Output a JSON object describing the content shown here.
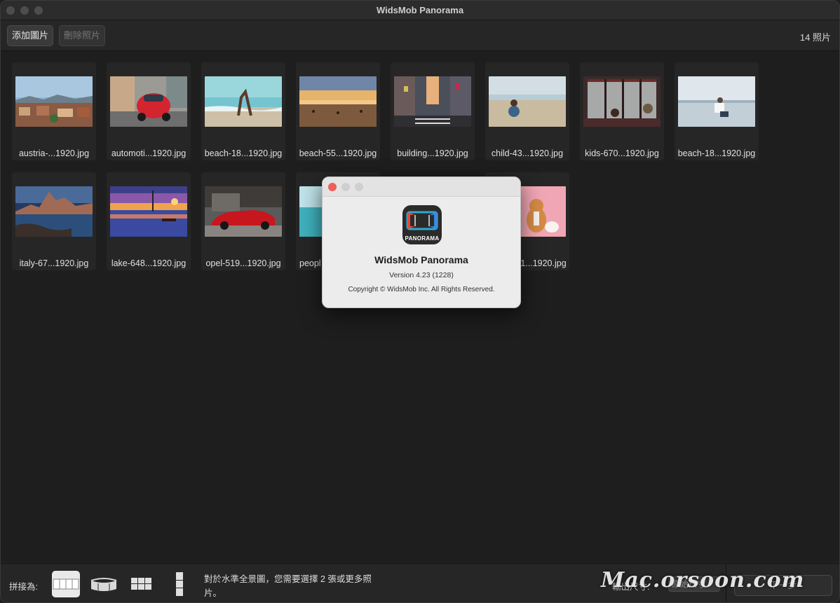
{
  "window": {
    "title": "WidsMob Panorama"
  },
  "toolbar": {
    "add_label": "添加圖片",
    "delete_label": "刪除照片",
    "photo_count": "14 照片"
  },
  "photos": [
    {
      "name": "austria-...1920.jpg",
      "scene": "austria-town"
    },
    {
      "name": "automoti...1920.jpg",
      "scene": "red-beetle-car"
    },
    {
      "name": "beach-18...1920.jpg",
      "scene": "beach-yoga"
    },
    {
      "name": "beach-55...1920.jpg",
      "scene": "beach-sunset"
    },
    {
      "name": "building...1920.jpg",
      "scene": "city-street"
    },
    {
      "name": "child-43...1920.jpg",
      "scene": "child-beach"
    },
    {
      "name": "kids-670...1920.jpg",
      "scene": "kids-window"
    },
    {
      "name": "beach-18...1920.jpg",
      "scene": "beach-sitting"
    },
    {
      "name": "italy-67...1920.jpg",
      "scene": "mountain-lake"
    },
    {
      "name": "lake-648...1920.jpg",
      "scene": "lake-sunset"
    },
    {
      "name": "opel-519...1920.jpg",
      "scene": "red-sports-car"
    },
    {
      "name": "peopl",
      "scene": "people-sea"
    },
    {
      "name": "1...1920.jpg",
      "scene": "corgi-pink"
    }
  ],
  "bottombar": {
    "stitch_label": "拼接為:",
    "modes": [
      "horizontal-panorama-icon",
      "360-panorama-icon",
      "grid-icon",
      "vertical-panorama-icon"
    ],
    "hint": "對於水準全景圖，您需要選擇 2 張或更多照片。",
    "output_label": "輸出尺寸:",
    "output_value": "原始尺寸",
    "next_label": "下一步"
  },
  "watermark": "Mac.orsoon.com",
  "about": {
    "icon_label": "PANORAMA",
    "name": "WidsMob Panorama",
    "version": "Version 4.23 (1228)",
    "copyright": "Copyright © WidsMob Inc. All Rights Reserved."
  }
}
